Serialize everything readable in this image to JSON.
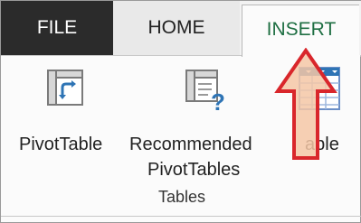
{
  "tabs": {
    "file": "FILE",
    "home": "HOME",
    "insert": "INSERT"
  },
  "commands": {
    "pivot_table": "PivotTable",
    "recommended_line1": "Recommended",
    "recommended_line2": "PivotTables",
    "table_partial": "able"
  },
  "group": {
    "label": "Tables"
  },
  "icons": {
    "pivot_table": "pivot-table-icon",
    "recommended_pivot": "recommended-pivottables-icon",
    "table": "table-icon",
    "arrow": "up-arrow-callout"
  },
  "colors": {
    "file_tab_bg": "#2b2b2b",
    "insert_tab_text": "#1f6f43",
    "arrow_fill": "#f4c7a6",
    "arrow_stroke": "#d9262b"
  }
}
